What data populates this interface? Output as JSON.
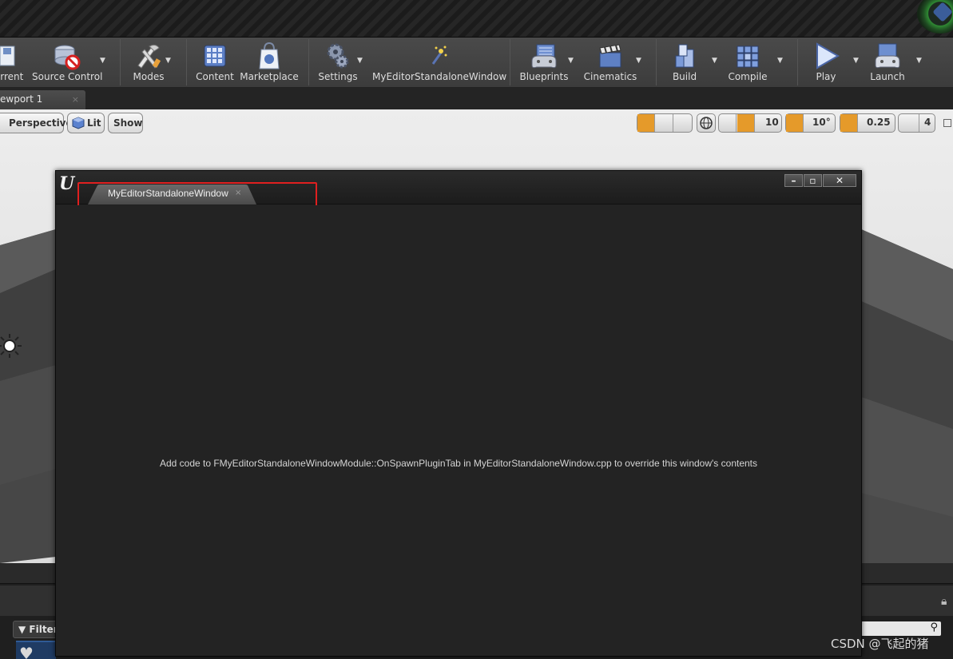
{
  "toolbar": {
    "buttons": [
      {
        "label": "urrent",
        "icon": "save-current-icon"
      },
      {
        "label": "Source Control",
        "icon": "source-control-icon"
      },
      {
        "label": "Modes",
        "icon": "modes-icon"
      },
      {
        "label": "Content",
        "icon": "content-browser-icon"
      },
      {
        "label": "Marketplace",
        "icon": "marketplace-icon"
      },
      {
        "label": "Settings",
        "icon": "settings-gear-icon"
      },
      {
        "label": "MyEditorStandaloneWindow",
        "icon": "plugin-wand-icon"
      },
      {
        "label": "Blueprints",
        "icon": "blueprints-icon"
      },
      {
        "label": "Cinematics",
        "icon": "cinematics-clapper-icon"
      },
      {
        "label": "Build",
        "icon": "build-icon"
      },
      {
        "label": "Compile",
        "icon": "compile-cubes-icon"
      },
      {
        "label": "Play",
        "icon": "play-icon"
      },
      {
        "label": "Launch",
        "icon": "launch-icon"
      }
    ]
  },
  "tabs": {
    "viewport_tab": "ewport 1",
    "close": "×"
  },
  "viewport": {
    "perspective": "Perspective",
    "lit": "Lit",
    "show": "Show",
    "grid_snap": "10",
    "rotation_snap": "10°",
    "scale_snap": "0.25",
    "camera_speed": "4"
  },
  "window": {
    "logo": "U",
    "tab_title": "MyEditorStandaloneWindow",
    "tab_close": "×",
    "minimize": "–",
    "maximize": "▫",
    "close": "✕",
    "message": "Add code to FMyEditorStandaloneWindowModule::OnSpawnPluginTab in MyEditorStandaloneWindow.cpp to override this window's contents"
  },
  "content_browser": {
    "filters": "Filters"
  },
  "watermark": "CSDN @飞起的猪",
  "colors": {
    "highlight": "#e01f1f",
    "accent_orange": "#e59a2a"
  }
}
